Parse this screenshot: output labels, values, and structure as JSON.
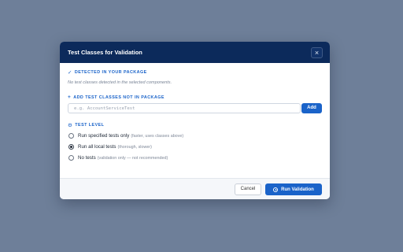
{
  "modal": {
    "title": "Test Classes for Validation",
    "close_glyph": "×"
  },
  "detected": {
    "glyph": "✓",
    "heading": "DETECTED IN YOUR PACKAGE",
    "empty_text": "No test classes detected in the selected components."
  },
  "add": {
    "glyph": "+",
    "heading": "ADD TEST CLASSES NOT IN PACKAGE",
    "placeholder": "e.g. AccountServiceTest",
    "value": "",
    "button_label": "Add"
  },
  "test_level": {
    "glyph": "⚙",
    "heading": "TEST LEVEL",
    "selected": "run-all-local",
    "options": [
      {
        "label": "Run specified tests only",
        "hint": "(faster, uses classes above)"
      },
      {
        "label": "Run all local tests",
        "hint": "(thorough, slower)"
      },
      {
        "label": "No tests",
        "hint": "(validation only — not recommended)"
      }
    ]
  },
  "footer": {
    "cancel_label": "Cancel",
    "run_label": "Run Validation"
  },
  "colors": {
    "header": "#0c2a5b",
    "accent": "#1a63c9",
    "backdrop": "#6e7f99"
  }
}
